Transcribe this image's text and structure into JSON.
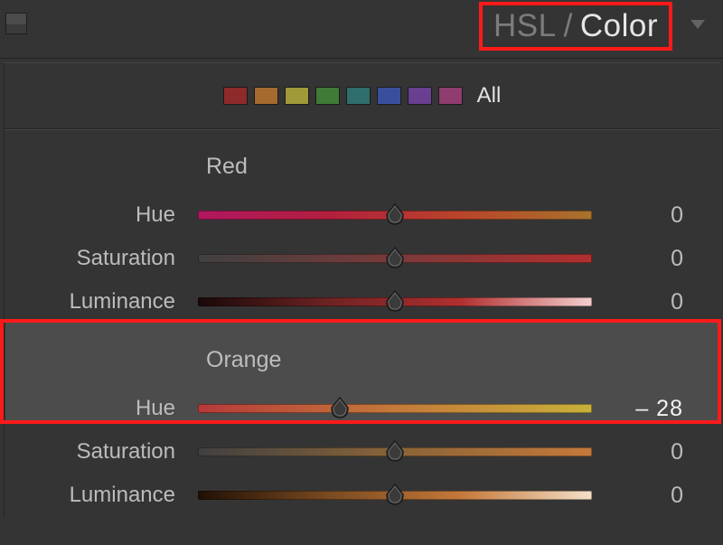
{
  "header": {
    "mode_dim": "HSL",
    "mode_bright": "Color"
  },
  "swatches": {
    "colors": [
      "#8e2a2a",
      "#a56a2e",
      "#a09a3a",
      "#3f7a36",
      "#2e6e6c",
      "#3a4f9c",
      "#6a3e90",
      "#8f3c6e"
    ],
    "all_label": "All"
  },
  "slider_labels": {
    "hue": "Hue",
    "saturation": "Saturation",
    "luminance": "Luminance"
  },
  "groups": [
    {
      "name": "Red",
      "hue": {
        "value": 0,
        "pos": 50,
        "grad": [
          "#b11760",
          "#b31f3e",
          "#b8452a",
          "#a8732c"
        ]
      },
      "saturation": {
        "value": 0,
        "pos": 50,
        "grad": [
          "#404040",
          "#7a3a3a",
          "#b12f2f"
        ]
      },
      "luminance": {
        "value": 0,
        "pos": 50,
        "grad": [
          "#1a0909",
          "#6e2323",
          "#b12f2f",
          "#f4d0d0"
        ]
      }
    },
    {
      "name": "Orange",
      "hue": {
        "value": "– 28",
        "pos": 36,
        "grad": [
          "#b63a3a",
          "#c4793a",
          "#c8b03a"
        ],
        "active": true
      },
      "saturation": {
        "value": 0,
        "pos": 50,
        "grad": [
          "#404040",
          "#8a6438",
          "#c4793a"
        ]
      },
      "luminance": {
        "value": 0,
        "pos": 50,
        "grad": [
          "#201005",
          "#7a4a20",
          "#c4793a",
          "#f4e0c8"
        ]
      }
    }
  ]
}
